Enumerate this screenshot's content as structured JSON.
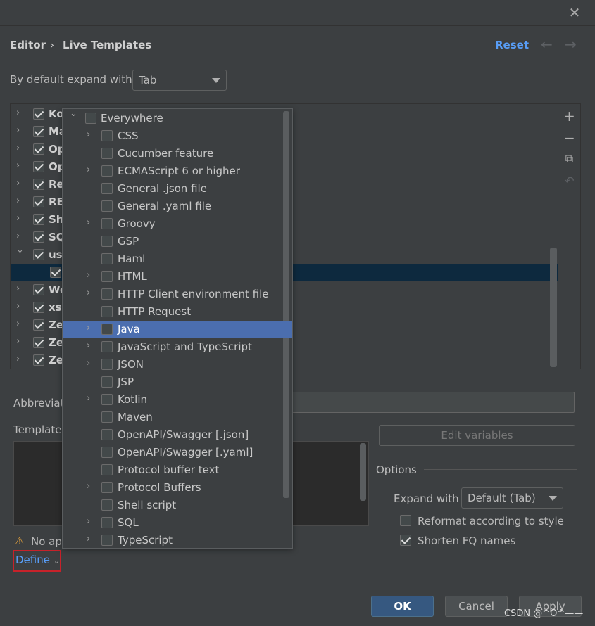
{
  "dialog": {
    "close_icon": "close-icon"
  },
  "header": {
    "breadcrumb": [
      "Editor",
      "Live Templates"
    ],
    "separator": "›",
    "reset_label": "Reset",
    "back_icon": "arrow-left-icon",
    "forward_icon": "arrow-right-icon"
  },
  "expand_default": {
    "label": "By default expand with",
    "value": "Tab"
  },
  "tree": {
    "rows": [
      {
        "label": "Ko",
        "checked": true,
        "expanded": false
      },
      {
        "label": "Ma",
        "checked": true,
        "expanded": false
      },
      {
        "label": "Op",
        "checked": true,
        "expanded": false
      },
      {
        "label": "Op",
        "checked": true,
        "expanded": false
      },
      {
        "label": "Re",
        "checked": true,
        "expanded": false
      },
      {
        "label": "RE",
        "checked": true,
        "expanded": false
      },
      {
        "label": "Sh",
        "checked": true,
        "expanded": false
      },
      {
        "label": "SQ",
        "checked": true,
        "expanded": false
      },
      {
        "label": "us",
        "checked": true,
        "expanded": true
      },
      {
        "label": "",
        "checked": true,
        "child": true,
        "selected": true
      },
      {
        "label": "We",
        "checked": true,
        "expanded": false
      },
      {
        "label": "xsl",
        "checked": true,
        "expanded": false
      },
      {
        "label": "Ze",
        "checked": true,
        "expanded": false
      },
      {
        "label": "Ze",
        "checked": true,
        "expanded": false
      },
      {
        "label": "Ze",
        "checked": true,
        "expanded": false
      }
    ]
  },
  "toolbar": {
    "add_icon": "plus-icon",
    "remove_icon": "minus-icon",
    "copy_icon": "copy-icon",
    "restore_icon": "undo-icon"
  },
  "context_popup": {
    "root": {
      "label": "Everywhere",
      "checked": false,
      "expanded": true
    },
    "items": [
      {
        "label": "CSS",
        "expandable": true
      },
      {
        "label": "Cucumber feature",
        "expandable": false
      },
      {
        "label": "ECMAScript 6 or higher",
        "expandable": true
      },
      {
        "label": "General .json file",
        "expandable": false
      },
      {
        "label": "General .yaml file",
        "expandable": false
      },
      {
        "label": "Groovy",
        "expandable": true
      },
      {
        "label": "GSP",
        "expandable": false
      },
      {
        "label": "Haml",
        "expandable": false
      },
      {
        "label": "HTML",
        "expandable": true
      },
      {
        "label": "HTTP Client environment file",
        "expandable": true
      },
      {
        "label": "HTTP Request",
        "expandable": false
      },
      {
        "label": "Java",
        "expandable": true,
        "highlighted": true
      },
      {
        "label": "JavaScript and TypeScript",
        "expandable": true
      },
      {
        "label": "JSON",
        "expandable": true
      },
      {
        "label": "JSP",
        "expandable": false
      },
      {
        "label": "Kotlin",
        "expandable": true
      },
      {
        "label": "Maven",
        "expandable": false
      },
      {
        "label": "OpenAPI/Swagger [.json]",
        "expandable": false
      },
      {
        "label": "OpenAPI/Swagger [.yaml]",
        "expandable": false
      },
      {
        "label": "Protocol buffer text",
        "expandable": false
      },
      {
        "label": "Protocol Buffers",
        "expandable": true
      },
      {
        "label": "Shell script",
        "expandable": false
      },
      {
        "label": "SQL",
        "expandable": true
      },
      {
        "label": "TypeScript",
        "expandable": true
      }
    ]
  },
  "form": {
    "abbreviation_label": "Abbreviat",
    "template_label": "Template",
    "edit_variables_label": "Edit variables",
    "options_label": "Options",
    "expand_with_label": "Expand with",
    "expand_with_value": "Default (Tab)",
    "reformat_label": "Reformat according to style",
    "reformat_checked": false,
    "shorten_label": "Shorten FQ names",
    "shorten_checked": true,
    "warning_text": "No ap",
    "warning_icon": "warning-icon",
    "define_label": "Define",
    "define_icon": "chevron-down-icon"
  },
  "footer": {
    "ok_label": "OK",
    "cancel_label": "Cancel",
    "apply_label": "Apply"
  },
  "watermark": "CSDN @^O^——"
}
